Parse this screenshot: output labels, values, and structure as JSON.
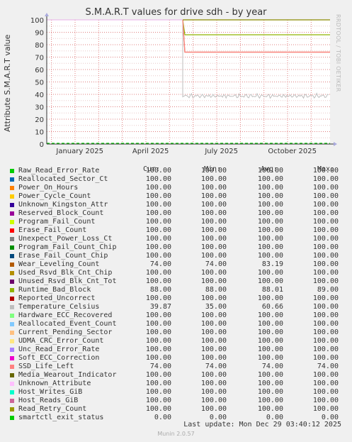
{
  "header": {
    "title": "S.M.A.R.T values for drive sdh - by year",
    "side_label": "RRDTOOL / TOBI OETIKER"
  },
  "legend_headers": {
    "cur": "Cur:",
    "min": "Min:",
    "avg": "Avg:",
    "max": "Max:"
  },
  "footer": {
    "last_update": "Last update:  Mon Dec 29 03:40:12 2025",
    "generator": "Munin 2.0.57"
  },
  "colors": {
    "plot_bg": "#ffffff",
    "page_bg": "#f0f0f0",
    "grid_major": "#e08080",
    "grid_minor": "#e8c8c8",
    "axis": "#333333"
  },
  "chart_data": {
    "type": "line",
    "title": "S.M.A.R.T values for drive sdh - by year",
    "ylabel": "Attribute S.M.A.R.T value",
    "xlabel": "",
    "ylim": [
      0,
      100
    ],
    "y_ticks": [
      0,
      10,
      20,
      30,
      40,
      50,
      60,
      70,
      80,
      90,
      100
    ],
    "x_ticks": [
      "January 2025",
      "April 2025",
      "July 2025",
      "October 2025"
    ],
    "grid": true,
    "data_start": "June 2025",
    "series": [
      {
        "name": "Raw_Read_Error_Rate",
        "color": "#00cc00",
        "cur": "100.00",
        "min": "100.00",
        "avg": "100.00",
        "max": "100.00",
        "level": 100
      },
      {
        "name": "Reallocated_Sector_Ct",
        "color": "#0066b3",
        "cur": "100.00",
        "min": "100.00",
        "avg": "100.00",
        "max": "100.00",
        "level": 100
      },
      {
        "name": "Power_On_Hours",
        "color": "#ff8000",
        "cur": "100.00",
        "min": "100.00",
        "avg": "100.00",
        "max": "100.00",
        "level": 100
      },
      {
        "name": "Power_Cycle_Count",
        "color": "#ffcc00",
        "cur": "100.00",
        "min": "100.00",
        "avg": "100.00",
        "max": "100.00",
        "level": 100
      },
      {
        "name": "Unknown_Kingston_Attr",
        "color": "#330099",
        "cur": "100.00",
        "min": "100.00",
        "avg": "100.00",
        "max": "100.00",
        "level": 100
      },
      {
        "name": "Reserved_Block_Count",
        "color": "#990099",
        "cur": "100.00",
        "min": "100.00",
        "avg": "100.00",
        "max": "100.00",
        "level": 100
      },
      {
        "name": "Program_Fail_Count",
        "color": "#ccff00",
        "cur": "100.00",
        "min": "100.00",
        "avg": "100.00",
        "max": "100.00",
        "level": 100
      },
      {
        "name": "Erase_Fail_Count",
        "color": "#ff0000",
        "cur": "100.00",
        "min": "100.00",
        "avg": "100.00",
        "max": "100.00",
        "level": 100
      },
      {
        "name": "Unexpect_Power_Loss_Ct",
        "color": "#808080",
        "cur": "100.00",
        "min": "100.00",
        "avg": "100.00",
        "max": "100.00",
        "level": 100
      },
      {
        "name": "Program_Fail_Count_Chip",
        "color": "#008f00",
        "cur": "100.00",
        "min": "100.00",
        "avg": "100.00",
        "max": "100.00",
        "level": 100
      },
      {
        "name": "Erase_Fail_Count_Chip",
        "color": "#00487d",
        "cur": "100.00",
        "min": "100.00",
        "avg": "100.00",
        "max": "100.00",
        "level": 100
      },
      {
        "name": "Wear_Leveling_Count",
        "color": "#b35a00",
        "cur": "74.00",
        "min": "74.00",
        "avg": "83.19",
        "max": "100.00",
        "level": 74
      },
      {
        "name": "Used_Rsvd_Blk_Cnt_Chip",
        "color": "#b38f00",
        "cur": "100.00",
        "min": "100.00",
        "avg": "100.00",
        "max": "100.00",
        "level": 100
      },
      {
        "name": "Unused_Rsvd_Blk_Cnt_Tot",
        "color": "#6b006b",
        "cur": "100.00",
        "min": "100.00",
        "avg": "100.00",
        "max": "100.00",
        "level": 100
      },
      {
        "name": "Runtime_Bad_Block",
        "color": "#8fb300",
        "cur": "88.00",
        "min": "88.00",
        "avg": "88.01",
        "max": "89.00",
        "level": 88
      },
      {
        "name": "Reported_Uncorrect",
        "color": "#b30000",
        "cur": "100.00",
        "min": "100.00",
        "avg": "100.00",
        "max": "100.00",
        "level": 100
      },
      {
        "name": "Temperature_Celsius",
        "color": "#bebebe",
        "cur": "39.87",
        "min": "35.00",
        "avg": "60.66",
        "max": "100.00",
        "level": 39
      },
      {
        "name": "Hardware_ECC_Recovered",
        "color": "#80ff80",
        "cur": "100.00",
        "min": "100.00",
        "avg": "100.00",
        "max": "100.00",
        "level": 100
      },
      {
        "name": "Reallocated_Event_Count",
        "color": "#80c9ff",
        "cur": "100.00",
        "min": "100.00",
        "avg": "100.00",
        "max": "100.00",
        "level": 100
      },
      {
        "name": "Current_Pending_Sector",
        "color": "#ffc080",
        "cur": "100.00",
        "min": "100.00",
        "avg": "100.00",
        "max": "100.00",
        "level": 100
      },
      {
        "name": "UDMA_CRC_Error_Count",
        "color": "#ffe680",
        "cur": "100.00",
        "min": "100.00",
        "avg": "100.00",
        "max": "100.00",
        "level": 100
      },
      {
        "name": "Unc_Read_Error_Rate",
        "color": "#aa80ff",
        "cur": "100.00",
        "min": "100.00",
        "avg": "100.00",
        "max": "100.00",
        "level": 100
      },
      {
        "name": "Soft_ECC_Correction",
        "color": "#ee00cc",
        "cur": "100.00",
        "min": "100.00",
        "avg": "100.00",
        "max": "100.00",
        "level": 100
      },
      {
        "name": "SSD_Life_Left",
        "color": "#ff8080",
        "cur": "74.00",
        "min": "74.00",
        "avg": "74.00",
        "max": "74.00",
        "level": 74
      },
      {
        "name": "Media_Wearout_Indicator",
        "color": "#666600",
        "cur": "100.00",
        "min": "100.00",
        "avg": "100.00",
        "max": "100.00",
        "level": 100
      },
      {
        "name": "Unknown_Attribute",
        "color": "#ffbfff",
        "cur": "100.00",
        "min": "100.00",
        "avg": "100.00",
        "max": "100.00",
        "level": 100
      },
      {
        "name": "Host_Writes_GiB",
        "color": "#00ffcc",
        "cur": "100.00",
        "min": "100.00",
        "avg": "100.00",
        "max": "100.00",
        "level": 100
      },
      {
        "name": "Host_Reads_GiB",
        "color": "#cc6699",
        "cur": "100.00",
        "min": "100.00",
        "avg": "100.00",
        "max": "100.00",
        "level": 100
      },
      {
        "name": "Read_Retry_Count",
        "color": "#999900",
        "cur": "100.00",
        "min": "100.00",
        "avg": "100.00",
        "max": "100.00",
        "level": 100
      },
      {
        "name": "smartctl_exit_status",
        "color": "#00cc00",
        "cur": "0.00",
        "min": "0.00",
        "avg": "0.00",
        "max": "0.00",
        "level": 0
      }
    ]
  }
}
